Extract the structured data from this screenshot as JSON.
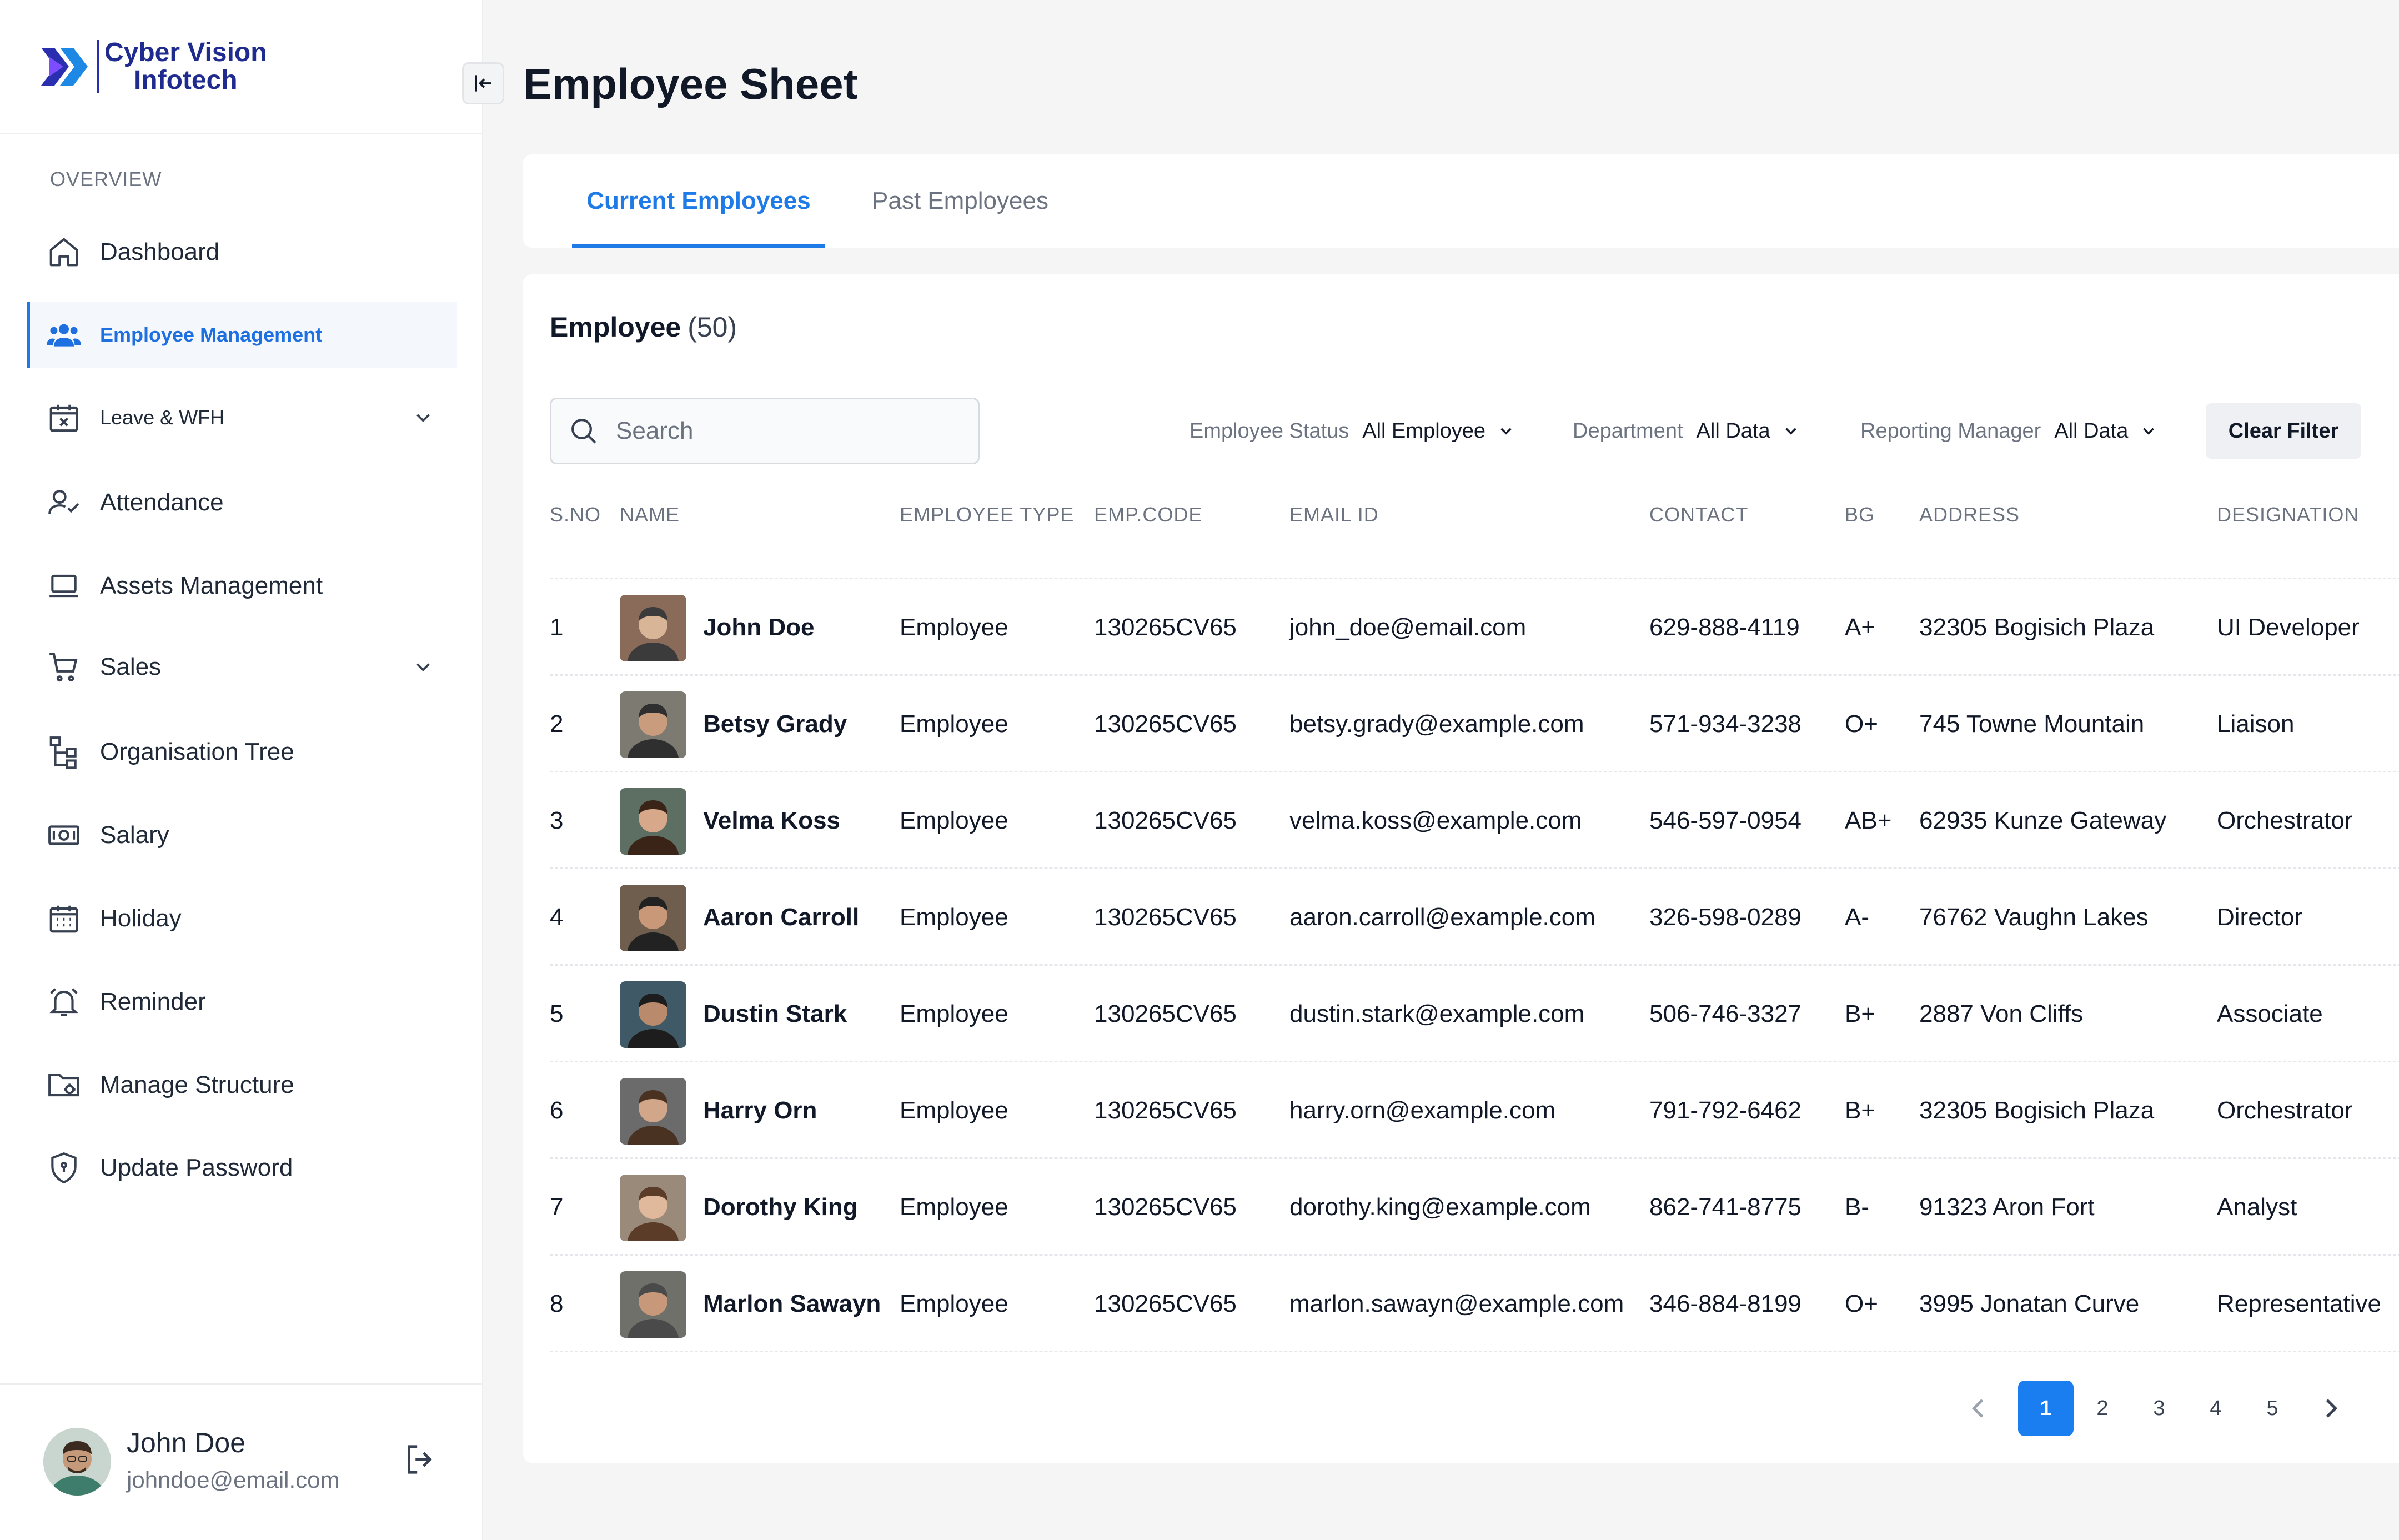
{
  "brand": {
    "line1": "Cyber Vision",
    "line2": "Infotech",
    "accent": "#1e7ae6"
  },
  "sidebar": {
    "section": "OVERVIEW",
    "items": [
      {
        "label": "Dashboard",
        "icon": "home-icon"
      },
      {
        "label": "Employee Management",
        "icon": "users-icon",
        "active": true
      },
      {
        "label": "Leave & WFH",
        "icon": "calendar-x-icon",
        "has_submenu": true
      },
      {
        "label": "Attendance",
        "icon": "user-check-icon"
      },
      {
        "label": "Assets Management",
        "icon": "laptop-icon"
      },
      {
        "label": "Sales",
        "icon": "cart-icon",
        "has_submenu": true
      },
      {
        "label": "Organisation Tree",
        "icon": "tree-icon"
      },
      {
        "label": "Salary",
        "icon": "money-icon"
      },
      {
        "label": "Holiday",
        "icon": "calendar-icon"
      },
      {
        "label": "Reminder",
        "icon": "bell-icon"
      },
      {
        "label": "Manage Structure",
        "icon": "folder-gear-icon"
      },
      {
        "label": "Update Password",
        "icon": "shield-icon"
      }
    ]
  },
  "profile": {
    "name": "John Doe",
    "email": "johndoe@email.com"
  },
  "page": {
    "title": "Employee Sheet"
  },
  "tabs": [
    {
      "label": "Current Employees",
      "active": true
    },
    {
      "label": "Past Employees",
      "active": false
    }
  ],
  "card": {
    "title": "Employee",
    "count": "(50)",
    "search_placeholder": "Search",
    "filters": [
      {
        "label": "Employee Status",
        "value": "All Employee"
      },
      {
        "label": "Department",
        "value": "All Data"
      },
      {
        "label": "Reporting Manager",
        "value": "All Data"
      }
    ],
    "clear_filter": "Clear Filter"
  },
  "table": {
    "columns": [
      "S.NO",
      "NAME",
      "EMPLOYEE TYPE",
      "EMP.CODE",
      "EMAIL ID",
      "CONTACT",
      "BG",
      "ADDRESS",
      "DESIGNATION"
    ],
    "rows": [
      {
        "sno": "1",
        "name": "John Doe",
        "type": "Employee",
        "code": "130265CV65",
        "email": "john_doe@email.com",
        "contact": "629-888-4119",
        "bg": "A+",
        "address": "32305 Bogisich Plaza",
        "designation": "UI Developer"
      },
      {
        "sno": "2",
        "name": "Betsy Grady",
        "type": "Employee",
        "code": "130265CV65",
        "email": "betsy.grady@example.com",
        "contact": "571-934-3238",
        "bg": "O+",
        "address": "745 Towne Mountain",
        "designation": "Liaison"
      },
      {
        "sno": "3",
        "name": "Velma Koss",
        "type": "Employee",
        "code": "130265CV65",
        "email": "velma.koss@example.com",
        "contact": "546-597-0954",
        "bg": "AB+",
        "address": "62935 Kunze Gateway",
        "designation": "Orchestrator"
      },
      {
        "sno": "4",
        "name": "Aaron Carroll",
        "type": "Employee",
        "code": "130265CV65",
        "email": "aaron.carroll@example.com",
        "contact": "326-598-0289",
        "bg": "A-",
        "address": "76762 Vaughn Lakes",
        "designation": "Director"
      },
      {
        "sno": "5",
        "name": "Dustin Stark",
        "type": "Employee",
        "code": "130265CV65",
        "email": "dustin.stark@example.com",
        "contact": "506-746-3327",
        "bg": "B+",
        "address": "2887 Von Cliffs",
        "designation": "Associate"
      },
      {
        "sno": "6",
        "name": "Harry Orn",
        "type": "Employee",
        "code": "130265CV65",
        "email": "harry.orn@example.com",
        "contact": "791-792-6462",
        "bg": "B+",
        "address": "32305 Bogisich Plaza",
        "designation": "Orchestrator"
      },
      {
        "sno": "7",
        "name": "Dorothy King",
        "type": "Employee",
        "code": "130265CV65",
        "email": "dorothy.king@example.com",
        "contact": "862-741-8775",
        "bg": "B-",
        "address": "91323 Aron Fort",
        "designation": "Analyst"
      },
      {
        "sno": "8",
        "name": "Marlon Sawayn",
        "type": "Employee",
        "code": "130265CV65",
        "email": "marlon.sawayn@example.com",
        "contact": "346-884-8199",
        "bg": "O+",
        "address": "3995 Jonatan Curve",
        "designation": "Representative"
      }
    ]
  },
  "pagination": {
    "pages": [
      "1",
      "2",
      "3",
      "4",
      "5"
    ],
    "current": "1"
  }
}
